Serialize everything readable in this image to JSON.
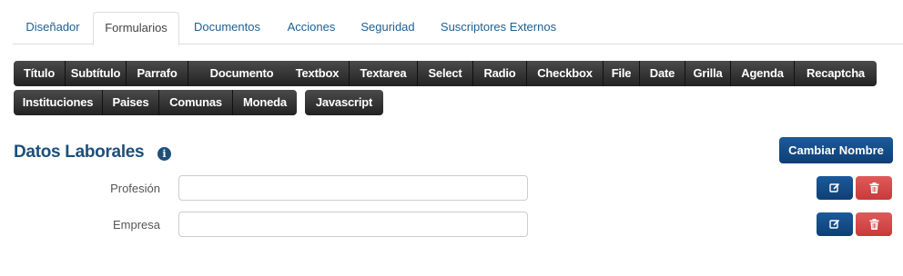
{
  "tabs": [
    {
      "label": "Diseñador",
      "active": false
    },
    {
      "label": "Formularios",
      "active": true
    },
    {
      "label": "Documentos",
      "active": false
    },
    {
      "label": "Acciones",
      "active": false
    },
    {
      "label": "Seguridad",
      "active": false
    },
    {
      "label": "Suscriptores Externos",
      "active": false
    }
  ],
  "toolbar": {
    "group1": [
      "Título",
      "Subtítulo",
      "Parrafo",
      "Documento"
    ],
    "group2": [
      "Textbox",
      "Textarea",
      "Select",
      "Radio",
      "Checkbox",
      "File",
      "Date",
      "Grilla",
      "Agenda",
      "Recaptcha"
    ],
    "group3": [
      "Instituciones",
      "Paises",
      "Comunas",
      "Moneda"
    ],
    "group4": [
      "Javascript"
    ]
  },
  "section": {
    "title": "Datos Laborales",
    "info_icon": "info-circle-icon",
    "rename_label": "Cambiar Nombre"
  },
  "fields": [
    {
      "label": "Profesión",
      "value": ""
    },
    {
      "label": "Empresa",
      "value": ""
    }
  ],
  "icons": {
    "edit": "edit-icon",
    "delete": "trash-icon"
  },
  "colors": {
    "accent": "#1d4f7a",
    "toolbar": "#2b2b2b",
    "danger": "#d9534f",
    "primary": "#164c86"
  }
}
